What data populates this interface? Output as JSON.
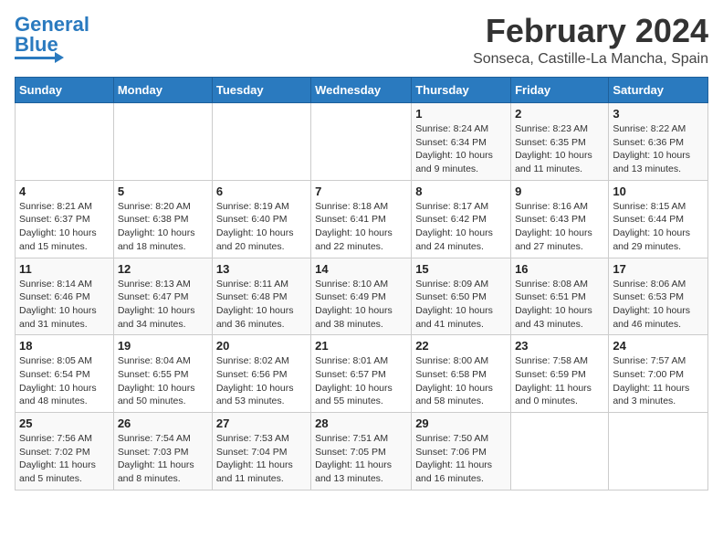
{
  "header": {
    "logo_text_general": "General",
    "logo_text_blue": "Blue",
    "month_title": "February 2024",
    "location": "Sonseca, Castille-La Mancha, Spain"
  },
  "days_of_week": [
    "Sunday",
    "Monday",
    "Tuesday",
    "Wednesday",
    "Thursday",
    "Friday",
    "Saturday"
  ],
  "weeks": [
    [
      {
        "num": "",
        "info": ""
      },
      {
        "num": "",
        "info": ""
      },
      {
        "num": "",
        "info": ""
      },
      {
        "num": "",
        "info": ""
      },
      {
        "num": "1",
        "info": "Sunrise: 8:24 AM\nSunset: 6:34 PM\nDaylight: 10 hours\nand 9 minutes."
      },
      {
        "num": "2",
        "info": "Sunrise: 8:23 AM\nSunset: 6:35 PM\nDaylight: 10 hours\nand 11 minutes."
      },
      {
        "num": "3",
        "info": "Sunrise: 8:22 AM\nSunset: 6:36 PM\nDaylight: 10 hours\nand 13 minutes."
      }
    ],
    [
      {
        "num": "4",
        "info": "Sunrise: 8:21 AM\nSunset: 6:37 PM\nDaylight: 10 hours\nand 15 minutes."
      },
      {
        "num": "5",
        "info": "Sunrise: 8:20 AM\nSunset: 6:38 PM\nDaylight: 10 hours\nand 18 minutes."
      },
      {
        "num": "6",
        "info": "Sunrise: 8:19 AM\nSunset: 6:40 PM\nDaylight: 10 hours\nand 20 minutes."
      },
      {
        "num": "7",
        "info": "Sunrise: 8:18 AM\nSunset: 6:41 PM\nDaylight: 10 hours\nand 22 minutes."
      },
      {
        "num": "8",
        "info": "Sunrise: 8:17 AM\nSunset: 6:42 PM\nDaylight: 10 hours\nand 24 minutes."
      },
      {
        "num": "9",
        "info": "Sunrise: 8:16 AM\nSunset: 6:43 PM\nDaylight: 10 hours\nand 27 minutes."
      },
      {
        "num": "10",
        "info": "Sunrise: 8:15 AM\nSunset: 6:44 PM\nDaylight: 10 hours\nand 29 minutes."
      }
    ],
    [
      {
        "num": "11",
        "info": "Sunrise: 8:14 AM\nSunset: 6:46 PM\nDaylight: 10 hours\nand 31 minutes."
      },
      {
        "num": "12",
        "info": "Sunrise: 8:13 AM\nSunset: 6:47 PM\nDaylight: 10 hours\nand 34 minutes."
      },
      {
        "num": "13",
        "info": "Sunrise: 8:11 AM\nSunset: 6:48 PM\nDaylight: 10 hours\nand 36 minutes."
      },
      {
        "num": "14",
        "info": "Sunrise: 8:10 AM\nSunset: 6:49 PM\nDaylight: 10 hours\nand 38 minutes."
      },
      {
        "num": "15",
        "info": "Sunrise: 8:09 AM\nSunset: 6:50 PM\nDaylight: 10 hours\nand 41 minutes."
      },
      {
        "num": "16",
        "info": "Sunrise: 8:08 AM\nSunset: 6:51 PM\nDaylight: 10 hours\nand 43 minutes."
      },
      {
        "num": "17",
        "info": "Sunrise: 8:06 AM\nSunset: 6:53 PM\nDaylight: 10 hours\nand 46 minutes."
      }
    ],
    [
      {
        "num": "18",
        "info": "Sunrise: 8:05 AM\nSunset: 6:54 PM\nDaylight: 10 hours\nand 48 minutes."
      },
      {
        "num": "19",
        "info": "Sunrise: 8:04 AM\nSunset: 6:55 PM\nDaylight: 10 hours\nand 50 minutes."
      },
      {
        "num": "20",
        "info": "Sunrise: 8:02 AM\nSunset: 6:56 PM\nDaylight: 10 hours\nand 53 minutes."
      },
      {
        "num": "21",
        "info": "Sunrise: 8:01 AM\nSunset: 6:57 PM\nDaylight: 10 hours\nand 55 minutes."
      },
      {
        "num": "22",
        "info": "Sunrise: 8:00 AM\nSunset: 6:58 PM\nDaylight: 10 hours\nand 58 minutes."
      },
      {
        "num": "23",
        "info": "Sunrise: 7:58 AM\nSunset: 6:59 PM\nDaylight: 11 hours\nand 0 minutes."
      },
      {
        "num": "24",
        "info": "Sunrise: 7:57 AM\nSunset: 7:00 PM\nDaylight: 11 hours\nand 3 minutes."
      }
    ],
    [
      {
        "num": "25",
        "info": "Sunrise: 7:56 AM\nSunset: 7:02 PM\nDaylight: 11 hours\nand 5 minutes."
      },
      {
        "num": "26",
        "info": "Sunrise: 7:54 AM\nSunset: 7:03 PM\nDaylight: 11 hours\nand 8 minutes."
      },
      {
        "num": "27",
        "info": "Sunrise: 7:53 AM\nSunset: 7:04 PM\nDaylight: 11 hours\nand 11 minutes."
      },
      {
        "num": "28",
        "info": "Sunrise: 7:51 AM\nSunset: 7:05 PM\nDaylight: 11 hours\nand 13 minutes."
      },
      {
        "num": "29",
        "info": "Sunrise: 7:50 AM\nSunset: 7:06 PM\nDaylight: 11 hours\nand 16 minutes."
      },
      {
        "num": "",
        "info": ""
      },
      {
        "num": "",
        "info": ""
      }
    ]
  ]
}
